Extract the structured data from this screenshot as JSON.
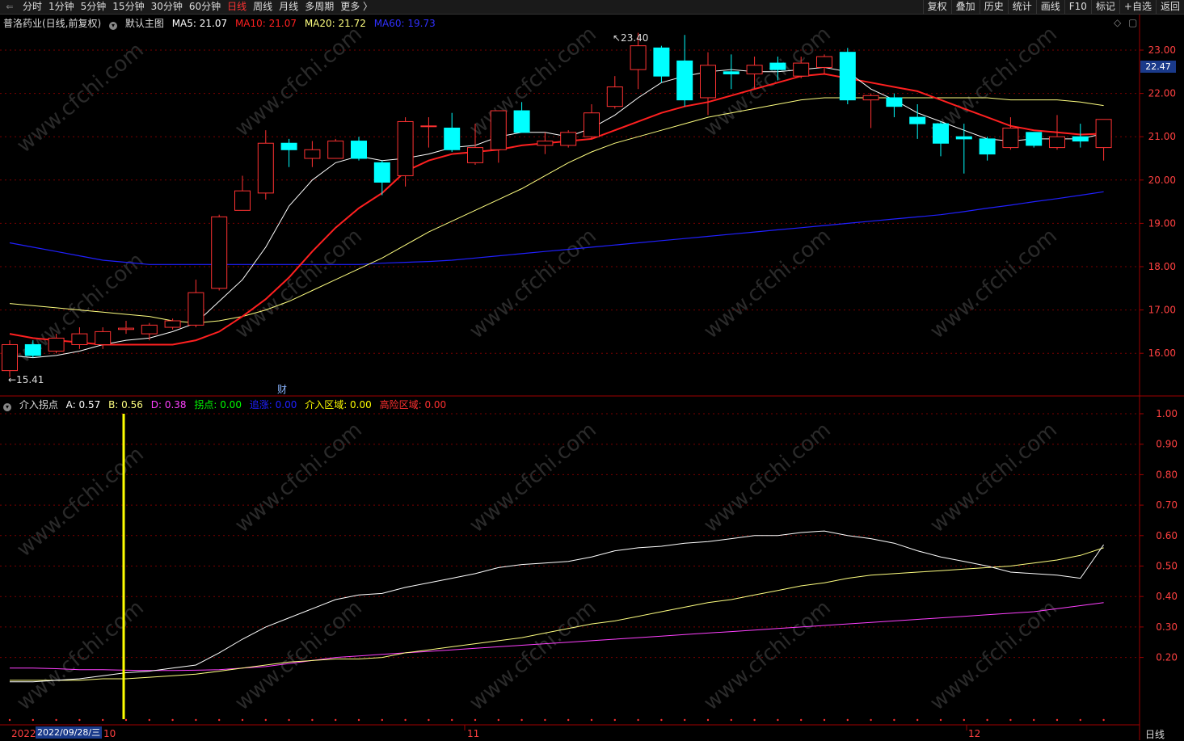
{
  "toolbar": {
    "periods": [
      "分时",
      "1分钟",
      "5分钟",
      "15分钟",
      "30分钟",
      "60分钟",
      "日线",
      "周线",
      "月线",
      "多周期",
      "更多 〉"
    ],
    "active_period": "日线",
    "right_buttons": [
      "复权",
      "叠加",
      "历史",
      "统计",
      "画线",
      "F10",
      "标记",
      "+自选",
      "返回"
    ]
  },
  "main_legend": {
    "stock": "普洛药业(日线,前复权)",
    "indicator": "默认主图",
    "ma5": "MA5: 21.07",
    "ma10": "MA10: 21.07",
    "ma20": "MA20: 21.72",
    "ma60": "MA60: 19.73"
  },
  "sub_legend": {
    "name": "介入拐点",
    "a": "A: 0.57",
    "b": "B: 0.56",
    "d": "D: 0.38",
    "guaidian": "拐点: 0.00",
    "zhuizhang": "追涨: 0.00",
    "jieru": "介入区域: 0.00",
    "gaoxian": "高险区域: 0.00"
  },
  "price_axis": [
    "23.00",
    "22.00",
    "21.00",
    "20.00",
    "19.00",
    "18.00",
    "17.00",
    "16.00"
  ],
  "current_price": "22.47",
  "sub_axis": [
    "1.00",
    "0.90",
    "0.80",
    "0.70",
    "0.60",
    "0.50",
    "0.40",
    "0.30",
    "0.20"
  ],
  "annotations": {
    "high": "23.40",
    "low": "15.41",
    "cai": "财"
  },
  "date_axis": {
    "start": "2022",
    "cursor_date": "2022/09/28/三",
    "m10": "10",
    "m11": "11",
    "m12": "12"
  },
  "period_label": "日线",
  "colors": {
    "up": "#ff3232",
    "down": "#00ffff",
    "ma5": "#ffffff",
    "ma10": "#ff2020",
    "ma20": "#ffff80",
    "ma60": "#2020ff",
    "d_line": "#ff40ff",
    "grid": "#7a0000"
  },
  "watermark": "www.cfchi.com",
  "chart_data": {
    "type": "candlestick",
    "candles": [
      {
        "o": 15.6,
        "c": 16.2,
        "h": 16.3,
        "l": 15.45
      },
      {
        "o": 16.2,
        "c": 15.95,
        "h": 16.3,
        "l": 15.9
      },
      {
        "o": 16.05,
        "c": 16.35,
        "h": 16.45,
        "l": 16.0
      },
      {
        "o": 16.2,
        "c": 16.45,
        "h": 16.6,
        "l": 16.1
      },
      {
        "o": 16.2,
        "c": 16.5,
        "h": 16.6,
        "l": 16.1
      },
      {
        "o": 16.55,
        "c": 16.58,
        "h": 16.75,
        "l": 16.45
      },
      {
        "o": 16.45,
        "c": 16.65,
        "h": 16.7,
        "l": 16.3
      },
      {
        "o": 16.6,
        "c": 16.75,
        "h": 16.8,
        "l": 16.55
      },
      {
        "o": 16.65,
        "c": 17.4,
        "h": 17.7,
        "l": 16.6
      },
      {
        "o": 17.5,
        "c": 19.15,
        "h": 19.2,
        "l": 17.45
      },
      {
        "o": 19.3,
        "c": 19.75,
        "h": 20.1,
        "l": 19.3
      },
      {
        "o": 19.7,
        "c": 20.85,
        "h": 21.15,
        "l": 19.55
      },
      {
        "o": 20.85,
        "c": 20.7,
        "h": 20.95,
        "l": 20.3
      },
      {
        "o": 20.5,
        "c": 20.7,
        "h": 20.9,
        "l": 20.3
      },
      {
        "o": 20.5,
        "c": 20.9,
        "h": 20.95,
        "l": 20.5
      },
      {
        "o": 20.9,
        "c": 20.5,
        "h": 21.0,
        "l": 20.45
      },
      {
        "o": 20.4,
        "c": 19.95,
        "h": 20.45,
        "l": 19.65
      },
      {
        "o": 20.1,
        "c": 21.35,
        "h": 21.45,
        "l": 19.85
      },
      {
        "o": 21.25,
        "c": 21.25,
        "h": 21.45,
        "l": 20.75
      },
      {
        "o": 21.2,
        "c": 20.7,
        "h": 21.55,
        "l": 20.65
      },
      {
        "o": 20.4,
        "c": 20.75,
        "h": 21.3,
        "l": 20.35
      },
      {
        "o": 20.7,
        "c": 21.6,
        "h": 21.6,
        "l": 20.4
      },
      {
        "o": 21.6,
        "c": 21.1,
        "h": 21.8,
        "l": 21.1
      },
      {
        "o": 20.8,
        "c": 20.9,
        "h": 21.1,
        "l": 20.6
      },
      {
        "o": 20.8,
        "c": 21.1,
        "h": 21.15,
        "l": 20.75
      },
      {
        "o": 21.0,
        "c": 21.55,
        "h": 21.75,
        "l": 20.95
      },
      {
        "o": 21.7,
        "c": 22.15,
        "h": 22.4,
        "l": 21.65
      },
      {
        "o": 22.55,
        "c": 23.1,
        "h": 23.4,
        "l": 22.1
      },
      {
        "o": 23.05,
        "c": 22.4,
        "h": 23.1,
        "l": 22.25
      },
      {
        "o": 22.75,
        "c": 21.85,
        "h": 23.35,
        "l": 21.7
      },
      {
        "o": 21.9,
        "c": 22.65,
        "h": 22.95,
        "l": 21.5
      },
      {
        "o": 22.5,
        "c": 22.45,
        "h": 22.9,
        "l": 22.1
      },
      {
        "o": 22.45,
        "c": 22.65,
        "h": 22.85,
        "l": 22.1
      },
      {
        "o": 22.7,
        "c": 22.55,
        "h": 22.85,
        "l": 22.3
      },
      {
        "o": 22.4,
        "c": 22.7,
        "h": 22.85,
        "l": 22.35
      },
      {
        "o": 22.6,
        "c": 22.85,
        "h": 22.9,
        "l": 22.45
      },
      {
        "o": 22.95,
        "c": 21.85,
        "h": 23.05,
        "l": 21.75
      },
      {
        "o": 21.85,
        "c": 21.95,
        "h": 22.0,
        "l": 21.2
      },
      {
        "o": 21.9,
        "c": 21.7,
        "h": 22.0,
        "l": 21.45
      },
      {
        "o": 21.45,
        "c": 21.3,
        "h": 21.75,
        "l": 20.95
      },
      {
        "o": 21.3,
        "c": 20.85,
        "h": 21.35,
        "l": 20.55
      },
      {
        "o": 21.0,
        "c": 20.95,
        "h": 21.3,
        "l": 20.15
      },
      {
        "o": 20.95,
        "c": 20.6,
        "h": 21.0,
        "l": 20.45
      },
      {
        "o": 20.75,
        "c": 21.2,
        "h": 21.45,
        "l": 20.7
      },
      {
        "o": 21.1,
        "c": 20.8,
        "h": 21.1,
        "l": 20.75
      },
      {
        "o": 20.75,
        "c": 21.0,
        "h": 21.5,
        "l": 20.7
      },
      {
        "o": 21.0,
        "c": 20.9,
        "h": 21.3,
        "l": 20.75
      },
      {
        "o": 20.75,
        "c": 21.4,
        "h": 21.4,
        "l": 20.45
      }
    ],
    "ma5": [
      15.95,
      15.9,
      15.95,
      16.05,
      16.2,
      16.3,
      16.35,
      16.5,
      16.7,
      17.2,
      17.7,
      18.45,
      19.4,
      20.0,
      20.4,
      20.55,
      20.45,
      20.5,
      20.6,
      20.75,
      20.8,
      21.0,
      21.1,
      21.1,
      21.0,
      21.2,
      21.5,
      21.9,
      22.25,
      22.4,
      22.5,
      22.55,
      22.5,
      22.5,
      22.55,
      22.6,
      22.5,
      22.1,
      21.85,
      21.55,
      21.35,
      21.15,
      20.95,
      20.9,
      20.95,
      20.95,
      20.95,
      21.07
    ],
    "ma10": [
      16.45,
      16.35,
      16.3,
      16.25,
      16.2,
      16.2,
      16.2,
      16.2,
      16.3,
      16.5,
      16.85,
      17.25,
      17.75,
      18.35,
      18.9,
      19.35,
      19.7,
      20.2,
      20.45,
      20.6,
      20.65,
      20.7,
      20.8,
      20.85,
      20.9,
      20.95,
      21.15,
      21.35,
      21.55,
      21.7,
      21.8,
      21.95,
      22.1,
      22.25,
      22.4,
      22.45,
      22.35,
      22.25,
      22.15,
      22.05,
      21.85,
      21.65,
      21.45,
      21.25,
      21.15,
      21.1,
      21.05,
      21.07
    ],
    "ma20": [
      17.15,
      17.1,
      17.05,
      17.0,
      16.95,
      16.9,
      16.85,
      16.75,
      16.7,
      16.75,
      16.85,
      17.0,
      17.2,
      17.45,
      17.7,
      17.95,
      18.2,
      18.5,
      18.8,
      19.05,
      19.3,
      19.55,
      19.8,
      20.1,
      20.4,
      20.65,
      20.85,
      21.0,
      21.15,
      21.3,
      21.45,
      21.55,
      21.65,
      21.75,
      21.85,
      21.9,
      21.9,
      21.9,
      21.9,
      21.9,
      21.9,
      21.9,
      21.9,
      21.85,
      21.85,
      21.85,
      21.8,
      21.72
    ],
    "ma60": [
      18.55,
      18.45,
      18.35,
      18.25,
      18.15,
      18.1,
      18.05,
      18.05,
      18.05,
      18.05,
      18.05,
      18.05,
      18.05,
      18.05,
      18.05,
      18.05,
      18.08,
      18.1,
      18.12,
      18.15,
      18.2,
      18.25,
      18.3,
      18.35,
      18.4,
      18.45,
      18.5,
      18.55,
      18.6,
      18.65,
      18.7,
      18.75,
      18.8,
      18.85,
      18.9,
      18.95,
      19.0,
      19.05,
      19.1,
      19.15,
      19.2,
      19.27,
      19.35,
      19.42,
      19.5,
      19.57,
      19.65,
      19.73
    ],
    "sub": {
      "A": [
        0.12,
        0.12,
        0.125,
        0.13,
        0.14,
        0.15,
        0.155,
        0.165,
        0.175,
        0.215,
        0.26,
        0.3,
        0.33,
        0.36,
        0.39,
        0.405,
        0.41,
        0.43,
        0.445,
        0.46,
        0.475,
        0.495,
        0.505,
        0.51,
        0.515,
        0.53,
        0.55,
        0.56,
        0.565,
        0.575,
        0.58,
        0.59,
        0.6,
        0.6,
        0.61,
        0.615,
        0.6,
        0.59,
        0.575,
        0.55,
        0.53,
        0.515,
        0.5,
        0.48,
        0.475,
        0.47,
        0.46,
        0.57
      ],
      "B": [
        0.125,
        0.125,
        0.125,
        0.125,
        0.13,
        0.13,
        0.135,
        0.14,
        0.145,
        0.155,
        0.165,
        0.175,
        0.185,
        0.19,
        0.195,
        0.195,
        0.2,
        0.215,
        0.225,
        0.235,
        0.245,
        0.255,
        0.265,
        0.28,
        0.295,
        0.31,
        0.32,
        0.335,
        0.35,
        0.365,
        0.38,
        0.39,
        0.405,
        0.42,
        0.435,
        0.445,
        0.46,
        0.47,
        0.475,
        0.48,
        0.485,
        0.49,
        0.495,
        0.5,
        0.51,
        0.52,
        0.535,
        0.56
      ],
      "D": [
        0.165,
        0.165,
        0.163,
        0.16,
        0.16,
        0.158,
        0.157,
        0.157,
        0.158,
        0.16,
        0.165,
        0.17,
        0.18,
        0.19,
        0.2,
        0.205,
        0.21,
        0.215,
        0.22,
        0.225,
        0.23,
        0.235,
        0.24,
        0.245,
        0.25,
        0.255,
        0.26,
        0.265,
        0.27,
        0.275,
        0.28,
        0.285,
        0.29,
        0.295,
        0.3,
        0.305,
        0.31,
        0.315,
        0.32,
        0.325,
        0.33,
        0.335,
        0.34,
        0.345,
        0.35,
        0.36,
        0.37,
        0.38
      ]
    },
    "ylim": [
      15.4,
      23.5
    ],
    "sub_ylim": [
      0.1,
      1.0
    ]
  }
}
